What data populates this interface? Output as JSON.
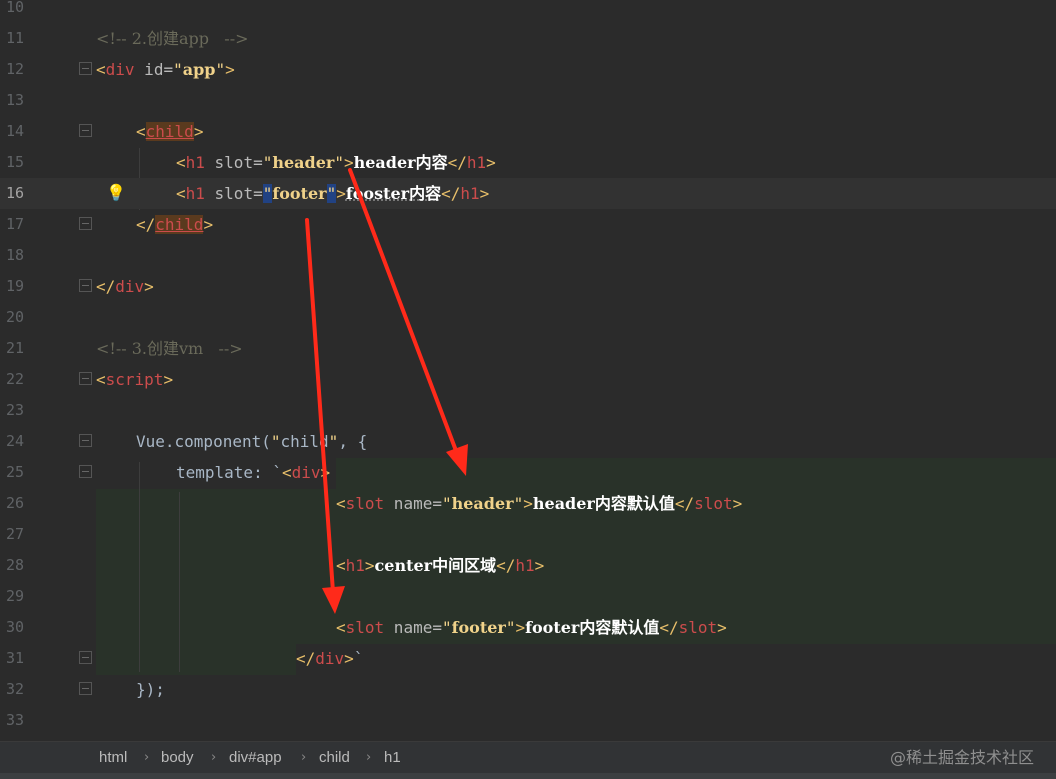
{
  "editor": {
    "lines": [
      {
        "n": "10"
      },
      {
        "n": "11",
        "comment": "<!-- 2.创建app   -->"
      },
      {
        "n": "12",
        "open": "<",
        "tag": "div",
        "attr": " id=",
        "q1": "\"",
        "val": "app",
        "q2": "\"",
        "close": ">"
      },
      {
        "n": "13"
      },
      {
        "n": "14",
        "open": "<",
        "tag": "child",
        "close": ">"
      },
      {
        "n": "15",
        "open": "<",
        "tag": "h1",
        "attr": " slot=",
        "q1": "\"",
        "val": "header",
        "q2": "\"",
        "close": ">",
        "text": "header内容",
        "eopen": "</",
        "etag": "h1",
        "eclose": ">"
      },
      {
        "n": "16",
        "open": "<",
        "tag": "h1",
        "attr": " slot=",
        "q1": "\"",
        "val": "footer",
        "q2": "\"",
        "close": ">",
        "text": "fooster内容",
        "eopen": "</",
        "etag": "h1",
        "eclose": ">"
      },
      {
        "n": "17",
        "open": "</",
        "tag": "child",
        "close": ">"
      },
      {
        "n": "18"
      },
      {
        "n": "19",
        "open": "</",
        "tag": "div",
        "close": ">"
      },
      {
        "n": "20"
      },
      {
        "n": "21",
        "comment": "<!-- 3.创建vm   -->"
      },
      {
        "n": "22",
        "open": "<",
        "tag": "script",
        "close": ">"
      },
      {
        "n": "23"
      },
      {
        "n": "24",
        "plain": "Vue.component(",
        "q1": "\"",
        "val2": "child",
        "q2": "\"",
        "plain2": ", {"
      },
      {
        "n": "25",
        "plain": "template: `",
        "open": "<",
        "tag": "div",
        "close": ">"
      },
      {
        "n": "26",
        "open": "<",
        "tag": "slot",
        "attr": " name=",
        "q1": "\"",
        "val": "header",
        "q2": "\"",
        "close": ">",
        "text": "header内容默认值",
        "eopen": "</",
        "etag": "slot",
        "eclose": ">"
      },
      {
        "n": "27"
      },
      {
        "n": "28",
        "open": "<",
        "tag": "h1",
        "close": ">",
        "text": "center中间区域",
        "eopen": "</",
        "etag": "h1",
        "eclose": ">"
      },
      {
        "n": "29"
      },
      {
        "n": "30",
        "open": "<",
        "tag": "slot",
        "attr": " name=",
        "q1": "\"",
        "val": "footer",
        "q2": "\"",
        "close": ">",
        "text": "footer内容默认值",
        "eopen": "</",
        "etag": "slot",
        "eclose": ">"
      },
      {
        "n": "31",
        "open": "</",
        "tag": "div",
        "close": ">",
        "plain2": "`"
      },
      {
        "n": "32",
        "plain": "});"
      },
      {
        "n": "33"
      }
    ]
  },
  "breadcrumb": {
    "items": [
      "html",
      "body",
      "div#app",
      "child",
      "h1"
    ],
    "separator": "›"
  },
  "watermark": "@稀土掘金技术社区",
  "icons": {
    "intention": "lightbulb-icon"
  },
  "colors": {
    "background": "#2b2b2b",
    "tag_name": "#cc4c4c",
    "string": "#f0d28a",
    "arrow": "#ff2a1a"
  }
}
